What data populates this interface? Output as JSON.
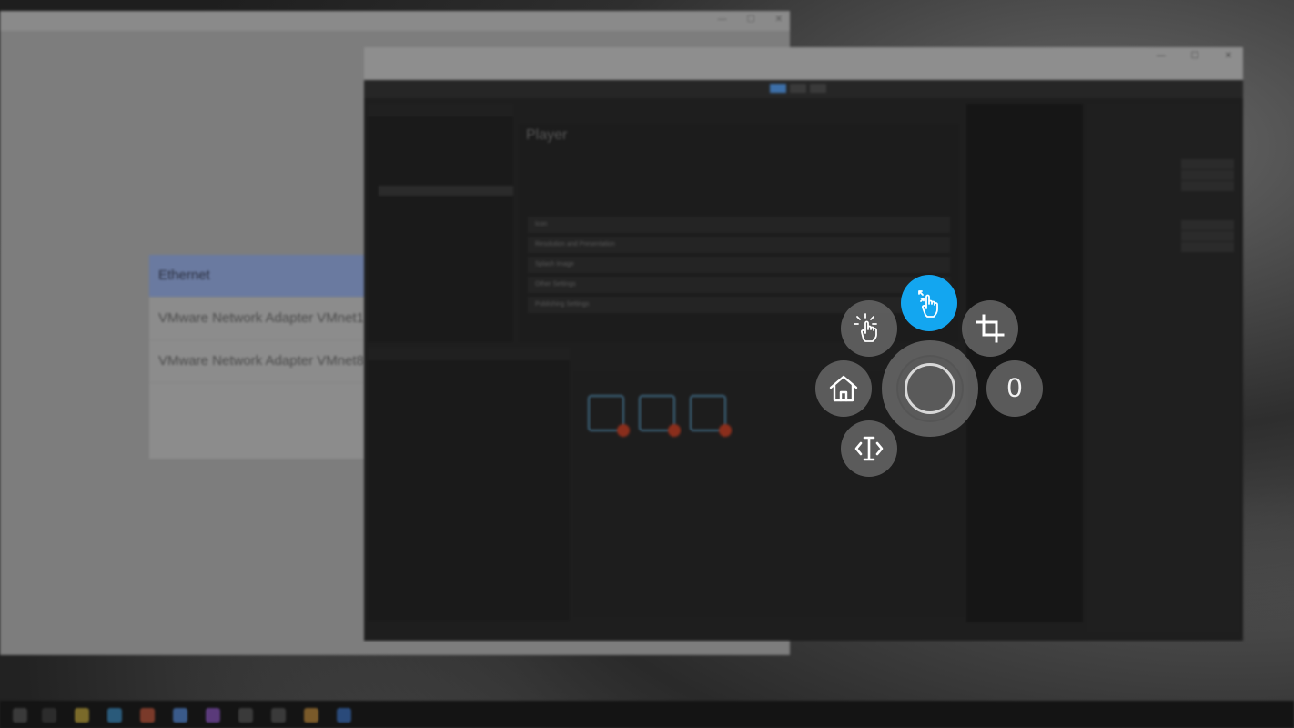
{
  "background_window": {
    "adapters": [
      {
        "label": "Ethernet",
        "selected": true
      },
      {
        "label": "VMware Network Adapter VMnet1",
        "selected": false
      },
      {
        "label": "VMware Network Adapter VMnet8",
        "selected": false
      }
    ]
  },
  "unity_editor": {
    "inspector_heading": "Player",
    "sections": [
      "Icon",
      "Resolution and Presentation",
      "Splash Image",
      "Other Settings",
      "Publishing Settings"
    ]
  },
  "assistive_menu": {
    "counter_value": "0",
    "active_color": "#13a6f0",
    "button_color": "#646464",
    "buttons": [
      {
        "name": "tap-gesture",
        "icon": "tap-pointer-icon",
        "active": false
      },
      {
        "name": "pinch-gesture",
        "icon": "pinch-hand-icon",
        "active": true
      },
      {
        "name": "crop",
        "icon": "crop-icon",
        "active": false
      },
      {
        "name": "home",
        "icon": "home-icon",
        "active": false
      },
      {
        "name": "text-cursor",
        "icon": "text-cursor-icon",
        "active": false
      },
      {
        "name": "counter",
        "icon": "",
        "active": false
      }
    ]
  }
}
